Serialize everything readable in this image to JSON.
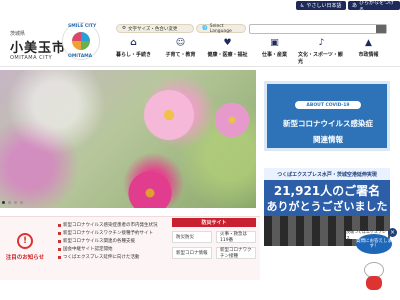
{
  "header": {
    "prefecture": "茨城県",
    "city_name": "小美玉市",
    "city_roman": "OMITAMA CITY",
    "emblem_text_top": "SMILE CITY",
    "emblem_text_bottom": "OMITAMA"
  },
  "top_buttons": [
    {
      "icon": "accessibility-icon",
      "label": "やさしい日本語"
    },
    {
      "icon": "hiragana-icon",
      "label": "ひらがなをつける"
    }
  ],
  "tools": {
    "font_color_label": "文字サイズ・色合い変更",
    "language_label": "Select Language",
    "search_placeholder": ""
  },
  "nav": [
    {
      "icon": "home-icon",
      "label": "暮らし・手続き"
    },
    {
      "icon": "family-icon",
      "label": "子育て・教育"
    },
    {
      "icon": "health-icon",
      "label": "健康・医療・福祉"
    },
    {
      "icon": "work-icon",
      "label": "仕事・産業"
    },
    {
      "icon": "culture-icon",
      "label": "文化・スポーツ・観光"
    },
    {
      "icon": "cityhall-icon",
      "label": "市政情報"
    }
  ],
  "banners": {
    "covid_tag": "ABOUT COVID-19",
    "covid_line1": "新型コロナウイルス感染症",
    "covid_line2": "関連情報",
    "tx_header": "つくばエクスプレス水戸・茨城空港延伸実現",
    "tx_count": "21,921人のご署名",
    "tx_thanks": "ありがとうございました",
    "tx_ribbon": "茨城つくばエクスプレス"
  },
  "notices": {
    "title": "注目のお知らせ",
    "items": [
      "新型コロナウイルス感染症患者の市内発生状況",
      "新型コロナウイルスワクチン接種予約サイト",
      "新型コロナウイルス関連の各種支援",
      "国会中継サイト認定開始",
      "つくばエクスプレス延伸に向けた活動"
    ]
  },
  "bosai": {
    "title": "防災サイト",
    "cells": [
      "防災防災",
      "火事・救急は119番",
      "新型コロナ情報",
      "新型コロナワクチン接種"
    ]
  },
  "assistant": {
    "bubble": "質問にお答えします！",
    "close": "×"
  }
}
